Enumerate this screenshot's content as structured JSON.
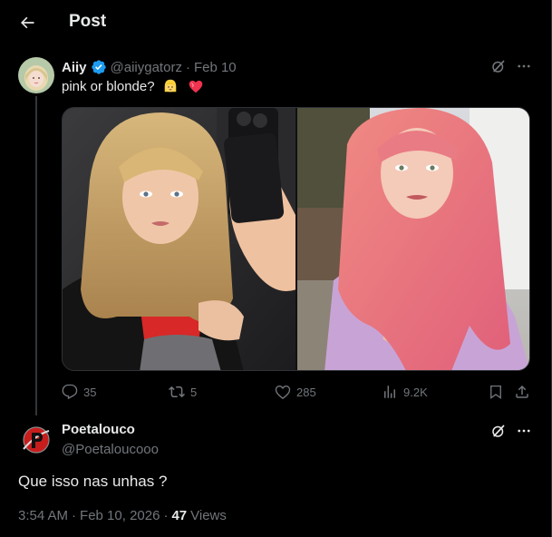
{
  "header": {
    "title": "Post",
    "back_icon": "arrow-left-icon"
  },
  "parent_post": {
    "author_name": "Aiiy",
    "verified": true,
    "handle": "@aiiygatorz",
    "separator": "·",
    "date": "Feb 10",
    "text": "pink or blonde?",
    "emojis": [
      "blonde-person-emoji",
      "red-heart-emoji"
    ],
    "media": {
      "count": 2,
      "items": [
        "blonde-selfie-photo",
        "pink-hair-selfie-photo"
      ]
    },
    "actions": {
      "replies": "35",
      "reposts": "5",
      "likes": "285",
      "views": "9.2K"
    }
  },
  "reply": {
    "author_name": "Poetalouco",
    "handle": "@Poetaloucooo",
    "text": "Que isso nas unhas ?",
    "time": "3:54 AM",
    "separator": "·",
    "date": "Feb 10, 2026",
    "separator2": "·",
    "views_count": "47",
    "views_label": "Views"
  },
  "colors": {
    "background": "#000000",
    "text_primary": "#e7e9ea",
    "text_secondary": "#71767b",
    "verified_blue": "#1d9bf0",
    "divider": "#2f3336"
  }
}
